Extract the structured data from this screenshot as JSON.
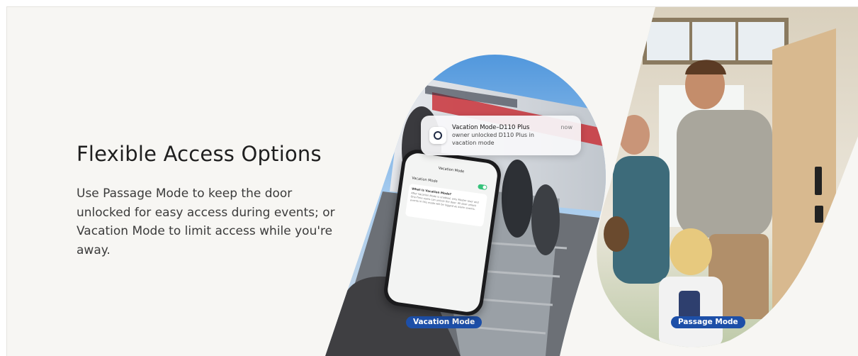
{
  "content": {
    "title": "Flexible Access Options",
    "description": "Use Passage Mode to keep the door unlocked for easy access during events; or Vacation Mode to limit access while you're away."
  },
  "notification": {
    "title": "Vacation Mode–D110 Plus",
    "time": "now",
    "body": "owner unlocked D110 Plus in vacation mode",
    "icon": "lock-app-icon"
  },
  "phone_screen": {
    "title": "Vacation Mode",
    "toggle_label": "Vacation Mode",
    "question": "What is Vacation Mode?",
    "answer": "After Vacation Mode is enabled, only Master User and One-Time users can unlock the door. All door unlock events in this mode will be logged as alarm events."
  },
  "badges": {
    "vacation": "Vacation Mode",
    "passage": "Passage Mode"
  },
  "colors": {
    "background": "#f7f6f3",
    "badge": "#1d4fa8",
    "toggle_on": "#35c27a",
    "title_text": "#1f1f1f"
  }
}
